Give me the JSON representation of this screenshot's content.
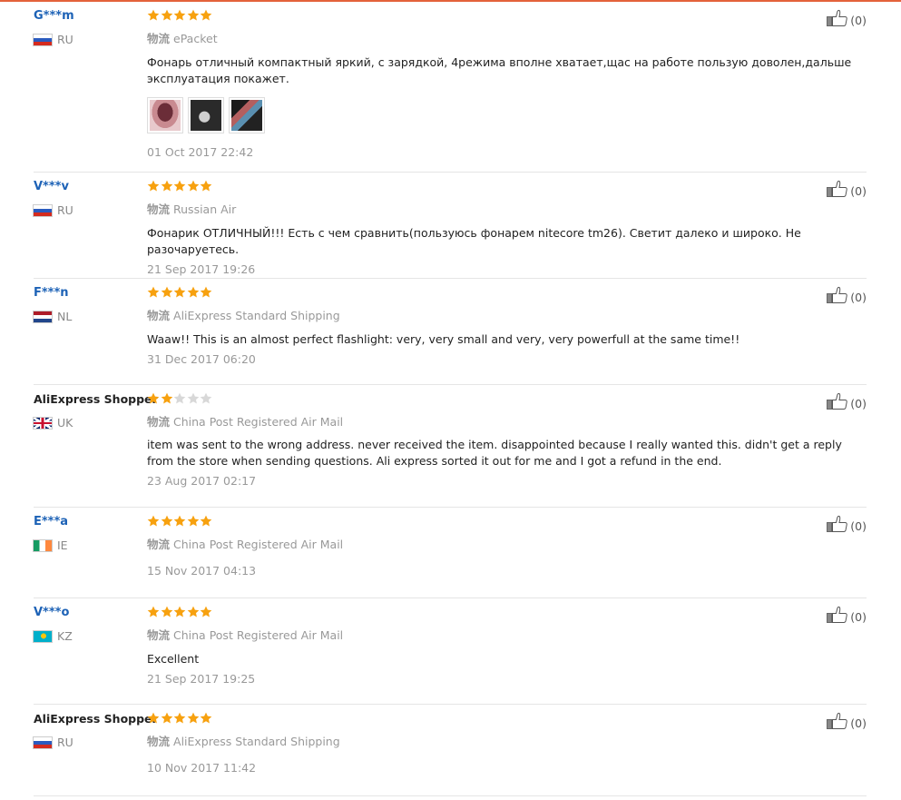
{
  "colors": {
    "accent_rule": "#e4623b",
    "username_link": "#1d62b6",
    "star_on": "#f7a10f",
    "star_off": "#d8d8d8",
    "muted_text": "#999999"
  },
  "reviews": [
    {
      "user": "G***m",
      "country": "RU",
      "stars": 5,
      "shipping_label": "物流",
      "shipping": "ePacket",
      "text": "Фонарь отличный компактный яркий, с зарядкой, 4режима вполне хватает,щас на работе пользую доволен,дальше эксплуатация покажет.",
      "date": "01 Oct 2017 22:42",
      "like_count": "(0)",
      "photos": [
        "photo-1",
        "photo-2",
        "photo-3"
      ]
    },
    {
      "user": "V***v",
      "country": "RU",
      "stars": 5,
      "shipping_label": "物流",
      "shipping": "Russian Air",
      "text": "Фонарик ОТЛИЧНЫЙ!!! Есть с чем сравнить(пользуюсь фонарем nitecore tm26). Светит далеко и широко. Не разочаруетесь.",
      "date": "21 Sep 2017 19:26",
      "like_count": "(0)"
    },
    {
      "user": "F***n",
      "country": "NL",
      "stars": 5,
      "shipping_label": "物流",
      "shipping": "AliExpress Standard Shipping",
      "text": "Waaw!! This is an almost perfect flashlight: very, very small and very, very powerfull at the same time!!",
      "date": "31 Dec 2017 06:20",
      "like_count": "(0)"
    },
    {
      "user": "AliExpress Shopper",
      "country": "UK",
      "stars": 2,
      "shipping_label": "物流",
      "shipping": "China Post Registered Air Mail",
      "text": "item was sent to the wrong address. never received the item. disappointed because I really wanted this. didn't get a reply from the store when sending questions. Ali express sorted it out for me and I got a refund in the end.",
      "date": "23 Aug 2017 02:17",
      "like_count": "(0)"
    },
    {
      "user": "E***a",
      "country": "IE",
      "stars": 5,
      "shipping_label": "物流",
      "shipping": "China Post Registered Air Mail",
      "date": "15 Nov 2017 04:13",
      "like_count": "(0)"
    },
    {
      "user": "V***o",
      "country": "KZ",
      "stars": 5,
      "shipping_label": "物流",
      "shipping": "China Post Registered Air Mail",
      "text": "Excellent",
      "date": "21 Sep 2017 19:25",
      "like_count": "(0)"
    },
    {
      "user": "AliExpress Shopper",
      "country": "RU",
      "stars": 5,
      "shipping_label": "物流",
      "shipping": "AliExpress Standard Shipping",
      "date": "10 Nov 2017 11:42",
      "like_count": "(0)"
    }
  ]
}
